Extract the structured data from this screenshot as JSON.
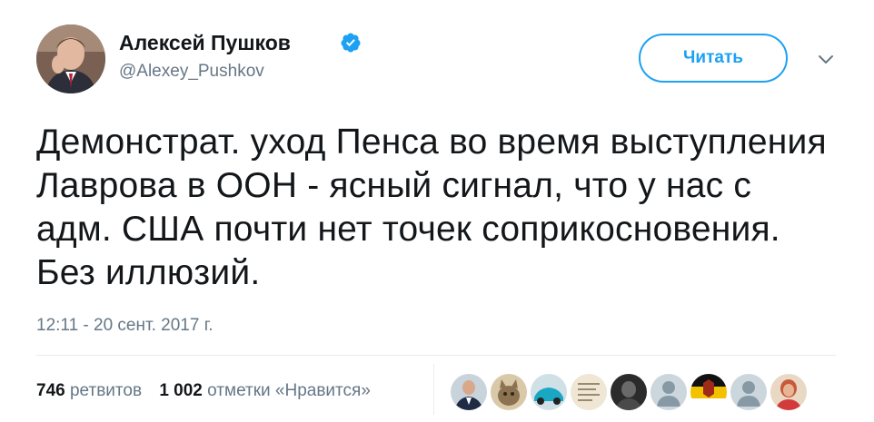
{
  "author": {
    "name": "Алексей Пушков",
    "handle": "@Alexey_Pushkov",
    "verified": true
  },
  "follow_button": {
    "label": "Читать"
  },
  "tweet": {
    "text": "Демонстрат. уход Пенса во время выступления Лаврова в ООН - ясный сигнал, что у нас с адм. США почти нет точек соприкосновения. Без иллюзий.",
    "timestamp": "12:11 - 20 сент. 2017 г."
  },
  "stats": {
    "retweets_count": "746",
    "retweets_label": "ретвитов",
    "likes_count": "1 002",
    "likes_label": "отметки «Нравится»"
  },
  "likers": [
    {
      "icon": "user-avatar-man-in-suit"
    },
    {
      "icon": "user-avatar-cat"
    },
    {
      "icon": "user-avatar-blue-car"
    },
    {
      "icon": "user-avatar-document"
    },
    {
      "icon": "user-avatar-dark-photo"
    },
    {
      "icon": "user-avatar-default-egg"
    },
    {
      "icon": "user-avatar-flag-emblem"
    },
    {
      "icon": "user-avatar-default-egg"
    },
    {
      "icon": "user-avatar-woman"
    }
  ],
  "colors": {
    "accent": "#1da1f2",
    "text": "#14171a",
    "secondary_text": "#657786",
    "divider": "#e6ecf0"
  }
}
